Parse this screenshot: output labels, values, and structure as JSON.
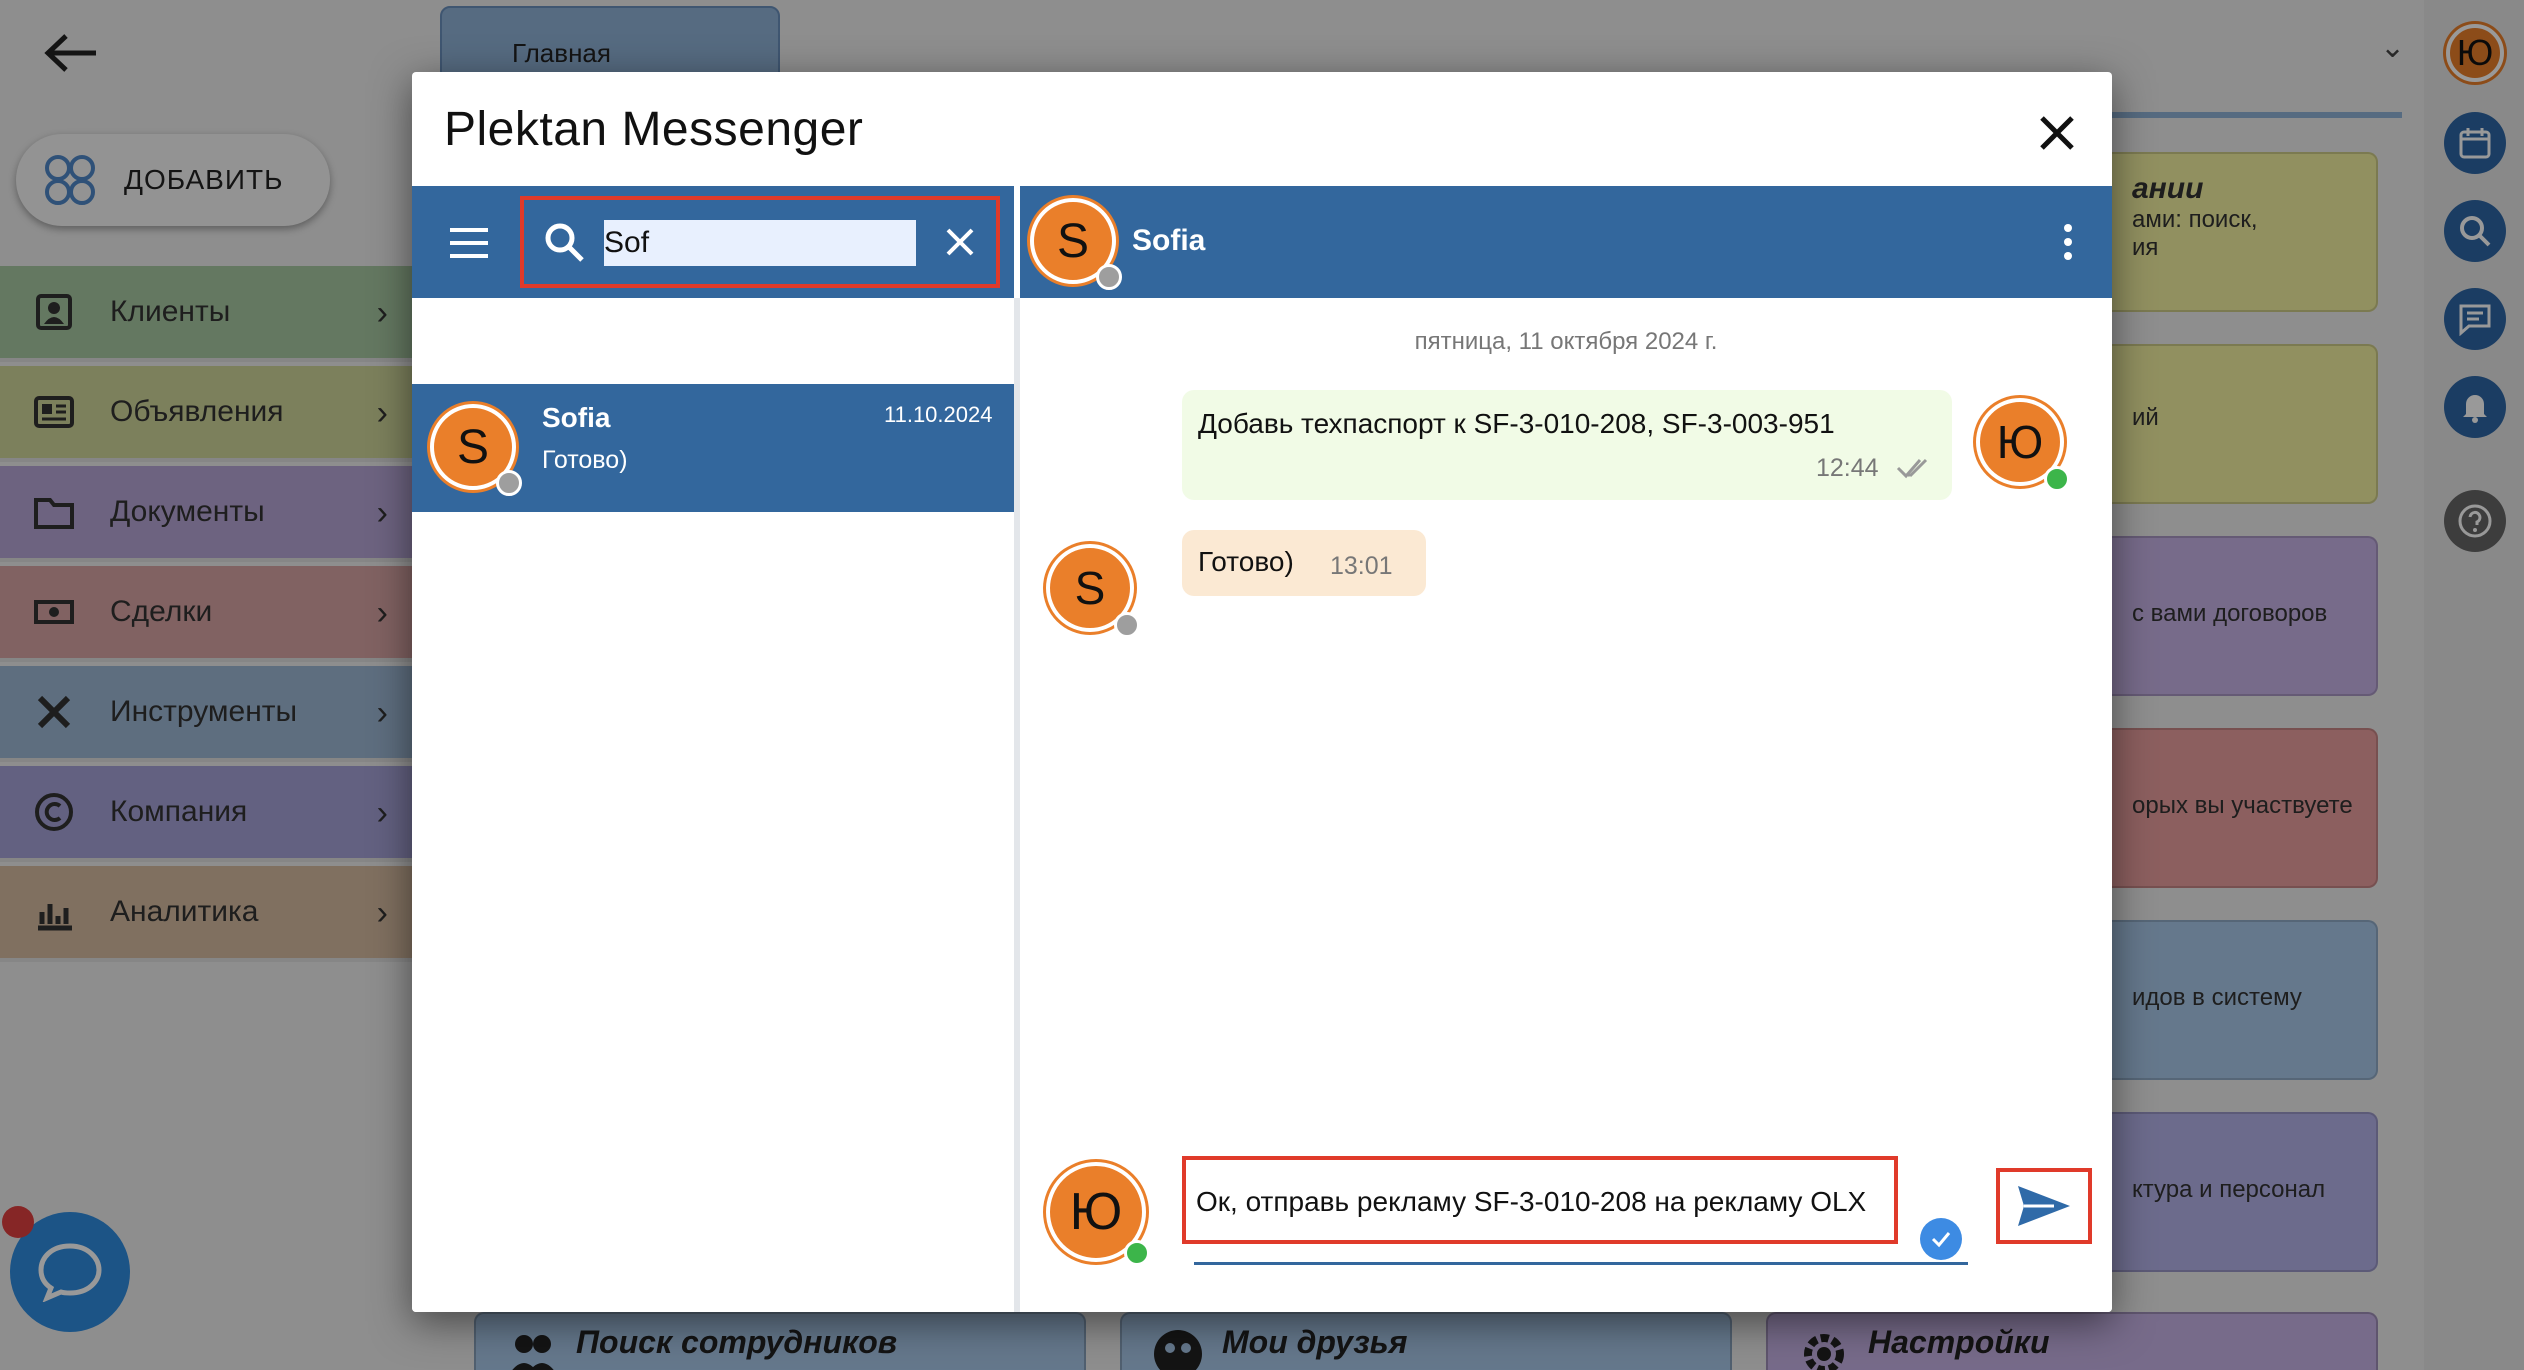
{
  "background": {
    "tab_main": "Главная",
    "add_button": "ДОБАВИТЬ",
    "nav": [
      {
        "label": "Клиенты",
        "icon": "clients-icon",
        "color": "#a7c8a2"
      },
      {
        "label": "Объявления",
        "icon": "ads-icon",
        "color": "#cfd59a"
      },
      {
        "label": "Документы",
        "icon": "folder-icon",
        "color": "#b6a5d6"
      },
      {
        "label": "Сделки",
        "icon": "money-icon",
        "color": "#d7a3a3"
      },
      {
        "label": "Инструменты",
        "icon": "tools-icon",
        "color": "#9db7d4"
      },
      {
        "label": "Компания",
        "icon": "copyright-icon",
        "color": "#a6a2d8"
      },
      {
        "label": "Аналитика",
        "icon": "analytics-icon",
        "color": "#d6bba0"
      }
    ],
    "cards": [
      {
        "title": "ании",
        "lines": [
          "ами: поиск,",
          "ия"
        ],
        "color": "#f2f0a0"
      },
      {
        "title": "",
        "lines": [
          "ий"
        ],
        "color": "#f2f0a0"
      },
      {
        "title": "",
        "lines": [
          "с вами договоров"
        ],
        "color": "#c6b2e6"
      },
      {
        "title": "",
        "lines": [
          "орых вы участвуете"
        ],
        "color": "#ea9e9e"
      },
      {
        "title": "",
        "lines": [
          "идов в систему"
        ],
        "color": "#a9c8ea"
      },
      {
        "title": "",
        "lines": [
          "ктура и персонал"
        ],
        "color": "#b4b2ea"
      }
    ],
    "bottom_cards": [
      "Поиск сотрудников",
      "Мои друзья",
      "Настройки"
    ],
    "user_avatar_letter": "Ю"
  },
  "modal": {
    "title": "Plektan Messenger",
    "search": {
      "value": "Sof"
    },
    "contacts": [
      {
        "name": "Sofia",
        "last_message": "Готово)",
        "date": "11.10.2024",
        "avatar_letter": "S"
      }
    ],
    "chat_header": {
      "name": "Sofia",
      "avatar_letter": "S"
    },
    "day_label": "пятница, 11 октября 2024 г.",
    "messages": [
      {
        "direction": "out",
        "text": "Добавь техпаспорт к SF-3-010-208, SF-3-003-951",
        "time": "12:44",
        "avatar_letter": "Ю"
      },
      {
        "direction": "in",
        "text": "Готово)",
        "time": "13:01",
        "avatar_letter": "S"
      }
    ],
    "compose": {
      "value": "Ок, отправь рекламу SF-3-010-208 на рекламу  OLX",
      "avatar_letter": "Ю"
    }
  },
  "colors": {
    "accent": "#33679d",
    "avatar": "#ea7f2a",
    "highlight": "#e03a2a",
    "online": "#3cb54a"
  }
}
